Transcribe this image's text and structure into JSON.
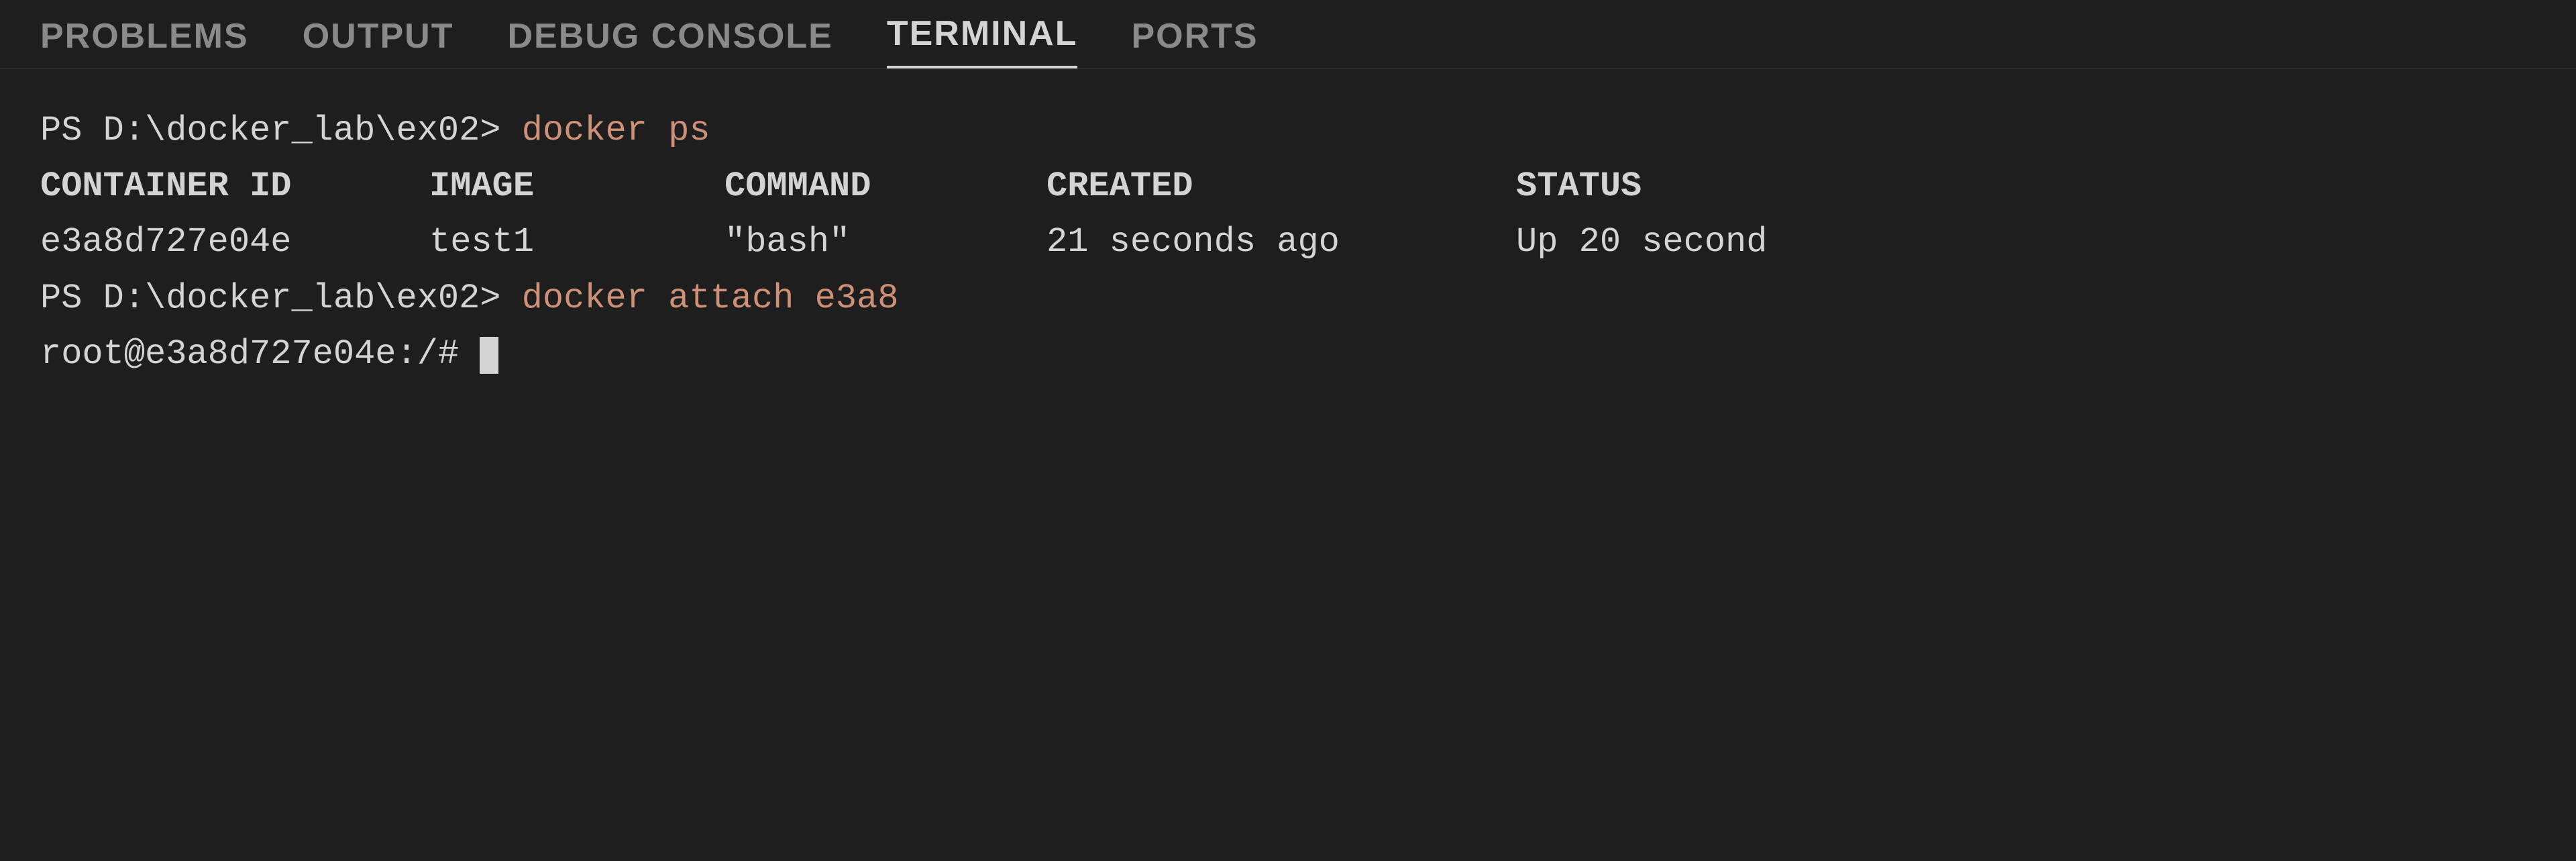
{
  "tabs": [
    {
      "label": "PROBLEMS",
      "active": false
    },
    {
      "label": "OUTPUT",
      "active": false
    },
    {
      "label": "DEBUG CONSOLE",
      "active": false
    },
    {
      "label": "TERMINAL",
      "active": true
    },
    {
      "label": "PORTS",
      "active": false
    }
  ],
  "terminal": {
    "line1_prompt": "PS D:\\docker_lab\\ex02>",
    "line1_command": " docker ps",
    "headers": {
      "container_id": "CONTAINER ID",
      "image": "IMAGE",
      "command": "COMMAND",
      "created": "CREATED",
      "status": "STATUS"
    },
    "row": {
      "container_id": "e3a8d727e04e",
      "image": "test1",
      "command": "\"bash\"",
      "created": "21 seconds ago",
      "status": "Up 20 second"
    },
    "line3_prompt": "PS D:\\docker_lab\\ex02>",
    "line3_command": " docker attach e3a8",
    "line4_prompt": "root@e3a8d727e04e:/#"
  }
}
